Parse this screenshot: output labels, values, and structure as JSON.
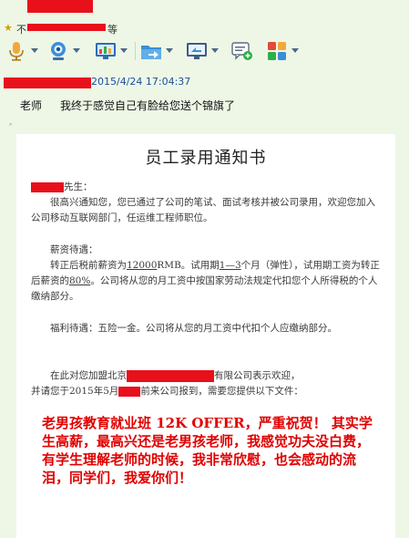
{
  "window": {
    "title_visible_fragment": "不",
    "title_suffix_fragment": "等"
  },
  "toolbar": {
    "buttons": [
      {
        "name": "voice",
        "icon": "microphone-icon"
      },
      {
        "name": "video",
        "icon": "webcam-icon"
      },
      {
        "name": "screen",
        "icon": "monitor-chart-icon"
      },
      {
        "name": "file",
        "icon": "folder-arrow-icon"
      },
      {
        "name": "remote",
        "icon": "remote-desktop-icon"
      },
      {
        "name": "message",
        "icon": "chat-add-icon"
      },
      {
        "name": "apps",
        "icon": "apps-grid-icon"
      }
    ]
  },
  "message": {
    "timestamp": "2015/4/24 17:04:37",
    "addressee": "老师",
    "text": "我终于感觉自己有脸给您送个锦旗了",
    "bullet": "。"
  },
  "document": {
    "title": "员工录用通知书",
    "salutation_suffix": "先生：",
    "p1": "很高兴通知您，您已通过了公司的笔试、面试考核并被公司录用，欢迎您加入公司移动互联网部门，任运维工程师职位。",
    "p2_heading": "薪资待遇：",
    "p2_a": "转正后税前薪资为",
    "p2_salary": "12000",
    "p2_b": "RMB。试用期",
    "p2_period": "1—3",
    "p2_c": "个月（弹性），试用期工资为转正后薪资的",
    "p2_pct": "80%",
    "p2_d": "。公司将从您的月工资中按国家劳动法规定代扣您个人所得税的个人缴纳部分。",
    "p3": "福利待遇：五险一金。公司将从您的月工资中代扣个人应缴纳部分。",
    "p4_a": "在此对您加盟北京",
    "p4_b": "有限公司表示欢迎，",
    "p4_c": "并请您于2015年5月",
    "p4_d": "前来公司报到，需要您提供以下文件：",
    "congrats": "老男孩教育就业班 12K OFFER，严重祝贺！ 其实学生高薪，最高兴还是老男孩老师，我感觉功夫没白费，有学生理解老师的时候，我非常欣慰，也会感动的流泪，同学们，我爱你们！"
  },
  "colors": {
    "background": "#eef7e6",
    "redaction": "#e8101a",
    "timestamp": "#1a4fa0",
    "congrats": "#e00000"
  }
}
